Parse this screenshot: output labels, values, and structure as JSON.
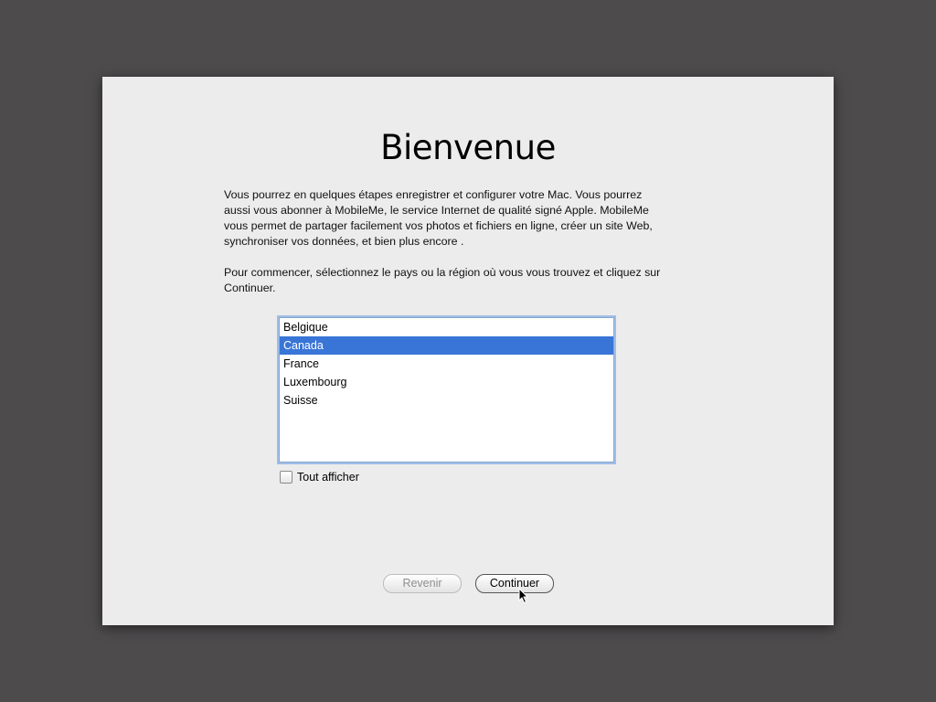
{
  "title": "Bienvenue",
  "intro": "Vous pourrez en quelques étapes enregistrer et configurer votre Mac. Vous pourrez aussi vous abonner à MobileMe, le service Internet de qualité signé Apple. MobileMe vous permet de partager facilement vos photos et fichiers en ligne, créer un site Web, synchroniser vos données, et bien plus encore .",
  "instruction": "Pour commencer, sélectionnez le pays ou la région où vous vous trouvez et cliquez sur Continuer.",
  "countries": [
    "Belgique",
    "Canada",
    "France",
    "Luxembourg",
    "Suisse"
  ],
  "selected_country": "Canada",
  "show_all_label": "Tout afficher",
  "show_all_checked": false,
  "buttons": {
    "back": "Revenir",
    "continue": "Continuer"
  },
  "colors": {
    "selection": "#3875d7",
    "background": "#4d4b4c"
  }
}
